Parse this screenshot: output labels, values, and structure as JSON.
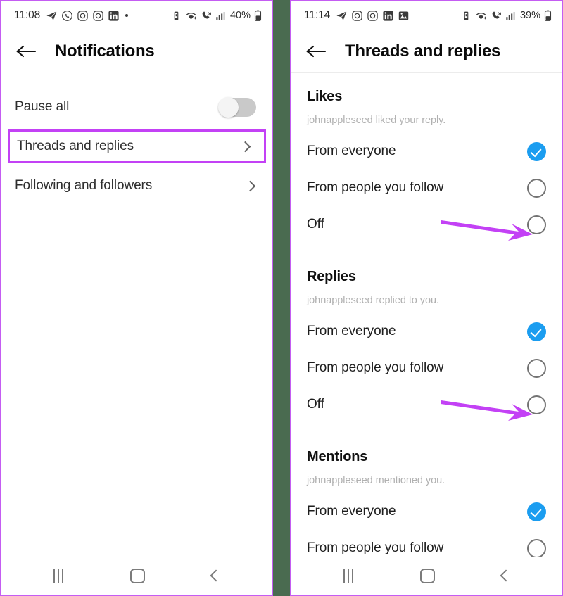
{
  "accent": {
    "annotation_purple": "#c341f5",
    "selected_blue": "#1b9df0",
    "divider_green": "#4a6b50"
  },
  "left_phone": {
    "statusbar": {
      "time": "11:08",
      "left_icons": [
        "telegram-icon",
        "whatsapp-icon",
        "instagram-icon",
        "instagram-icon",
        "linkedin-icon",
        "dot-icon"
      ],
      "right_icons": [
        "vibrate-icon",
        "wifi-icon",
        "missed-call-icon",
        "signal-icon"
      ],
      "battery": "40%"
    },
    "appbar": {
      "back": "back-arrow",
      "title": "Notifications"
    },
    "rows": [
      {
        "label": "Pause all",
        "control": "toggle",
        "toggle_on": false
      },
      {
        "label": "Threads and replies",
        "control": "chevron",
        "highlighted": true
      },
      {
        "label": "Following and followers",
        "control": "chevron",
        "highlighted": false
      }
    ],
    "navbar": [
      "recents-icon",
      "home-icon",
      "back-icon"
    ]
  },
  "right_phone": {
    "statusbar": {
      "time": "11:14",
      "left_icons": [
        "telegram-icon",
        "instagram-icon",
        "instagram-icon",
        "linkedin-icon",
        "gallery-icon"
      ],
      "right_icons": [
        "vibrate-icon",
        "wifi-icon",
        "missed-call-icon",
        "signal-icon"
      ],
      "battery": "39%"
    },
    "appbar": {
      "back": "back-arrow",
      "title": "Threads and replies"
    },
    "sections": [
      {
        "title": "Likes",
        "subtitle": "johnappleseed liked your reply.",
        "options": [
          {
            "label": "From everyone",
            "selected": true
          },
          {
            "label": "From people you follow",
            "selected": false
          },
          {
            "label": "Off",
            "selected": false
          }
        ]
      },
      {
        "title": "Replies",
        "subtitle": "johnappleseed replied to you.",
        "options": [
          {
            "label": "From everyone",
            "selected": true
          },
          {
            "label": "From people you follow",
            "selected": false
          },
          {
            "label": "Off",
            "selected": false
          }
        ]
      },
      {
        "title": "Mentions",
        "subtitle": "johnappleseed mentioned you.",
        "options": [
          {
            "label": "From everyone",
            "selected": true
          },
          {
            "label": "From people you follow",
            "selected": false
          }
        ]
      }
    ],
    "navbar": [
      "recents-icon",
      "home-icon",
      "back-icon"
    ]
  },
  "annotations": {
    "highlight_box_target": "Threads and replies",
    "arrows": [
      {
        "points_at": "Off radio in Likes section"
      },
      {
        "points_at": "Off radio in Replies section"
      }
    ]
  }
}
